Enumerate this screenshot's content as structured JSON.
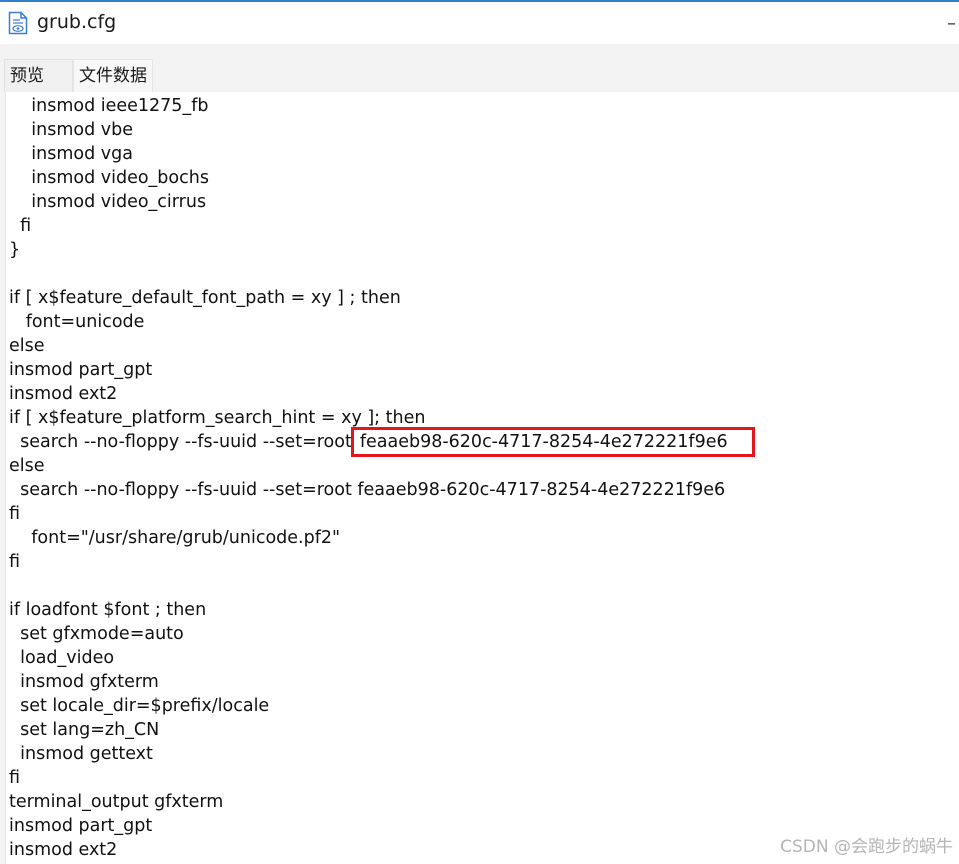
{
  "window": {
    "title": "grub.cfg",
    "minimize_label": "–",
    "icon": "document-eye-icon",
    "accent_color": "#2f7fc9"
  },
  "tabs": [
    {
      "label": "预览"
    },
    {
      "label": "文件数据"
    }
  ],
  "code_lines": [
    "    insmod ieee1275_fb",
    "    insmod vbe",
    "    insmod vga",
    "    insmod video_bochs",
    "    insmod video_cirrus",
    "  fi",
    "}",
    "",
    "if [ x$feature_default_font_path = xy ] ; then",
    "   font=unicode",
    "else",
    "insmod part_gpt",
    "insmod ext2",
    "if [ x$feature_platform_search_hint = xy ]; then",
    "  search --no-floppy --fs-uuid --set=root",
    "else",
    "  search --no-floppy --fs-uuid --set=root feaaeb98-620c-4717-8254-4e272221f9e6",
    "fi",
    "    font=\"/usr/share/grub/unicode.pf2\"",
    "fi",
    "",
    "if loadfont $font ; then",
    "  set gfxmode=auto",
    "  load_video",
    "  insmod gfxterm",
    "  set locale_dir=$prefix/locale",
    "  set lang=zh_CN",
    "  insmod gettext",
    "fi",
    "terminal_output gfxterm",
    "insmod part_gpt",
    "insmod ext2"
  ],
  "highlighted_uuid": "feaaeb98-620c-4717-8254-4e272221f9e6",
  "highlight_color": "#e5151b",
  "watermark": "CSDN @会跑步的蜗牛"
}
